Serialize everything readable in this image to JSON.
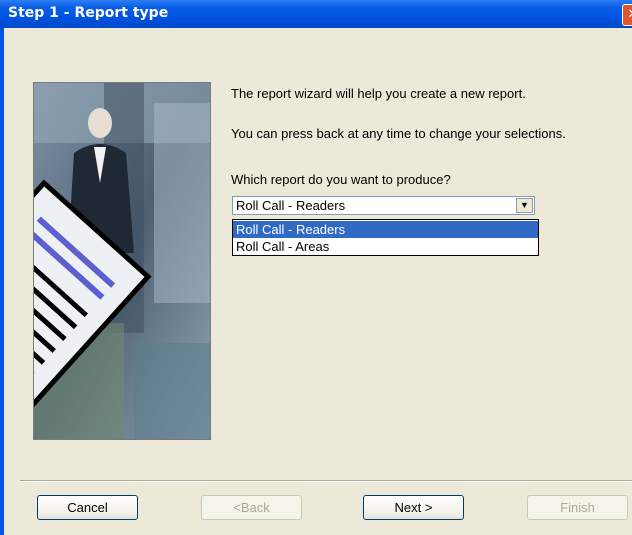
{
  "window": {
    "title": "Step 1 - Report type",
    "close_glyph": "✕"
  },
  "intro": {
    "line1": "The report wizard will help you create a new report.",
    "line2": "You can press back at any time to change your selections.",
    "question": "Which report do you want to produce?"
  },
  "report_select": {
    "selected": "Roll Call - Readers",
    "options": [
      "Roll Call - Readers",
      "Roll Call - Areas"
    ],
    "arrow_icon": "▼"
  },
  "buttons": {
    "cancel": "Cancel",
    "back": "<Back",
    "next": "Next >",
    "finish": "Finish"
  },
  "colors": {
    "titlebar": "#0054e3",
    "selection": "#316ac5",
    "dialog_bg": "#ECE9D8"
  }
}
